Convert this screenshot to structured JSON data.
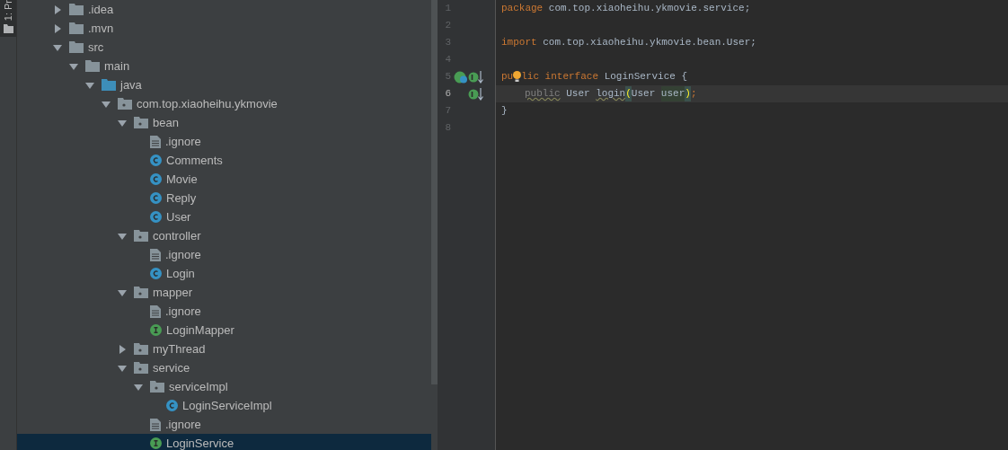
{
  "tool_window_tab": {
    "label": "1: Pr"
  },
  "tree": [
    {
      "label": ".idea",
      "kind": "folder",
      "expanded": false,
      "selected": false
    },
    {
      "label": ".mvn",
      "kind": "folder",
      "expanded": false,
      "selected": false
    },
    {
      "label": "src",
      "kind": "folder",
      "expanded": true,
      "selected": false,
      "children": [
        {
          "label": "main",
          "kind": "folder",
          "expanded": true,
          "selected": false,
          "children": [
            {
              "label": "java",
              "kind": "source_folder",
              "expanded": true,
              "selected": false,
              "children": [
                {
                  "label": "com.top.xiaoheihu.ykmovie",
                  "kind": "package",
                  "expanded": true,
                  "selected": false,
                  "children": [
                    {
                      "label": "bean",
                      "kind": "package",
                      "expanded": true,
                      "selected": false,
                      "children": [
                        {
                          "label": ".ignore",
                          "kind": "file",
                          "selected": false
                        },
                        {
                          "label": "Comments",
                          "kind": "class",
                          "selected": false
                        },
                        {
                          "label": "Movie",
                          "kind": "class",
                          "selected": false
                        },
                        {
                          "label": "Reply",
                          "kind": "class",
                          "selected": false
                        },
                        {
                          "label": "User",
                          "kind": "class",
                          "selected": false
                        }
                      ]
                    },
                    {
                      "label": "controller",
                      "kind": "package",
                      "expanded": true,
                      "selected": false,
                      "children": [
                        {
                          "label": ".ignore",
                          "kind": "file",
                          "selected": false
                        },
                        {
                          "label": "Login",
                          "kind": "class",
                          "selected": false
                        }
                      ]
                    },
                    {
                      "label": "mapper",
                      "kind": "package",
                      "expanded": true,
                      "selected": false,
                      "children": [
                        {
                          "label": ".ignore",
                          "kind": "file",
                          "selected": false
                        },
                        {
                          "label": "LoginMapper",
                          "kind": "interface",
                          "selected": false
                        }
                      ]
                    },
                    {
                      "label": "myThread",
                      "kind": "package",
                      "expanded": false,
                      "selected": false
                    },
                    {
                      "label": "service",
                      "kind": "package",
                      "expanded": true,
                      "selected": false,
                      "children": [
                        {
                          "label": "serviceImpl",
                          "kind": "package",
                          "expanded": true,
                          "selected": false,
                          "children": [
                            {
                              "label": "LoginServiceImpl",
                              "kind": "class",
                              "selected": false
                            }
                          ]
                        },
                        {
                          "label": ".ignore",
                          "kind": "file",
                          "selected": false
                        },
                        {
                          "label": "LoginService",
                          "kind": "interface",
                          "selected": true
                        }
                      ]
                    }
                  ]
                }
              ]
            }
          ]
        }
      ]
    }
  ],
  "editor": {
    "lines": [
      {
        "number": "1",
        "tokens": [
          {
            "kind": "keyword",
            "text": "package"
          },
          {
            "kind": "plain",
            "text": " com.top.xiaoheihu.ykmovie.service;"
          }
        ]
      },
      {
        "number": "2"
      },
      {
        "number": "3",
        "tokens": [
          {
            "kind": "keyword",
            "text": "import"
          },
          {
            "kind": "plain",
            "text": " com.top.xiaoheihu.ykmovie.bean.User;"
          }
        ]
      },
      {
        "number": "4"
      },
      {
        "number": "5",
        "gutter": [
          {
            "kind": "implemented"
          },
          {
            "kind": "implementing"
          }
        ],
        "bulb": true,
        "tokens": [
          {
            "kind": "keyword",
            "text": "pu"
          },
          {
            "kind": "keyword",
            "text": "lic interface"
          },
          {
            "kind": "plain",
            "text": " LoginService {"
          }
        ]
      },
      {
        "number": "6",
        "current": true,
        "indented": true,
        "gutter": [
          {
            "kind": "implementing"
          }
        ],
        "tokens": [
          {
            "kind": "unused",
            "text": "public"
          },
          {
            "kind": "plain",
            "text": " User "
          },
          {
            "kind": "warned",
            "text": "login"
          },
          {
            "kind": "bracket",
            "text": "("
          },
          {
            "kind": "plain",
            "text": "User "
          },
          {
            "kind": "highlight",
            "text": "user"
          },
          {
            "kind": "bracket",
            "text": ")"
          },
          {
            "kind": "keyword",
            "text": ";"
          }
        ]
      },
      {
        "number": "7",
        "tokens": [
          {
            "kind": "plain",
            "text": "}"
          }
        ]
      },
      {
        "number": "8"
      }
    ]
  }
}
